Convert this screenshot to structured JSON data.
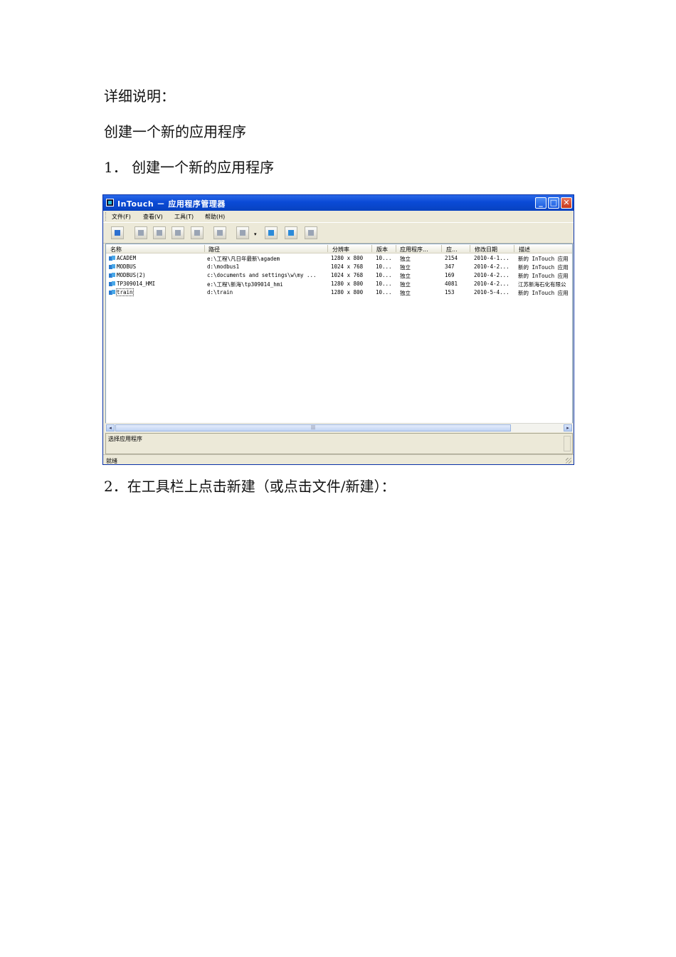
{
  "doc": {
    "heading": "详细说明：",
    "subheading": "创建一个新的应用程序",
    "step1": "1．  创建一个新的应用程序",
    "step2": "2．在工具栏上点击新建（或点击文件/新建）："
  },
  "window": {
    "title": "InTouch － 应用程序管理器",
    "menu": [
      "文件(F)",
      "查看(V)",
      "工具(T)",
      "帮助(H)"
    ],
    "columns": [
      "名称",
      "路径",
      "分辨率",
      "版本",
      "应用程序...",
      "应...",
      "修改日期",
      "描述"
    ],
    "rows": [
      [
        "ACADEM",
        "e:\\工程\\凡日年最新\\agadem",
        "1280 x 800",
        "10...",
        "独立",
        "2154",
        "2010-4-1...",
        "新的 InTouch 应用"
      ],
      [
        "MODBUS",
        "d:\\modbus1",
        "1024 x 768",
        "10...",
        "独立",
        "347",
        "2010-4-2...",
        "新的 InTouch 应用"
      ],
      [
        "MODBUS(2)",
        "c:\\documents and settings\\w\\my ...",
        "1024 x 768",
        "10...",
        "独立",
        "169",
        "2010-4-2...",
        "新的 InTouch 应用"
      ],
      [
        "TP309014_HMI",
        "e:\\工程\\新海\\tp309014_hmi",
        "1280 x 800",
        "10...",
        "独立",
        "4081",
        "2010-4-2...",
        "江苏新海石化有限公"
      ],
      [
        "train",
        "d:\\train",
        "1280 x 800",
        "10...",
        "独立",
        "153",
        "2010-5-4...",
        "新的 InTouch 应用"
      ]
    ],
    "description_label": "选择应用程序",
    "status": "就绪",
    "scroll_thumb": "|||"
  }
}
